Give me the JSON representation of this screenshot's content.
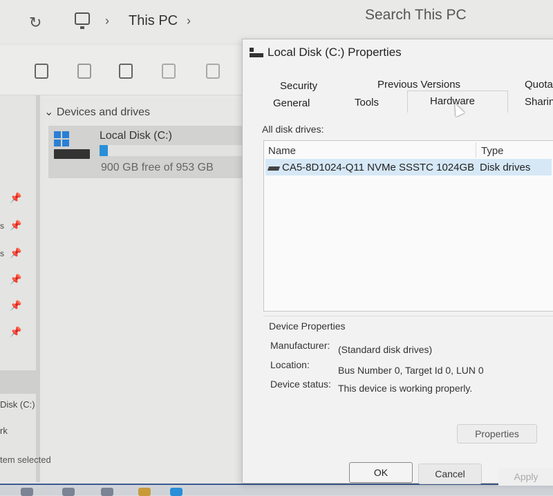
{
  "explorer": {
    "breadcrumb": "This PC",
    "search_placeholder": "Search This PC",
    "devices_header": "Devices and drives",
    "disk": {
      "name": "Local Disk (C:)",
      "free_text": "900 GB free of 953 GB",
      "usage_fraction": 0.056
    },
    "nav": {
      "frag1": "s",
      "frag2": "s",
      "disk_label": "Disk (C:)",
      "frag3": "rk"
    },
    "status_text": "tem selected"
  },
  "dialog": {
    "title": "Local Disk (C:) Properties",
    "tabs": {
      "security": "Security",
      "previous_versions": "Previous Versions",
      "quota": "Quota",
      "general": "General",
      "tools": "Tools",
      "hardware": "Hardware",
      "sharing": "Sharing"
    },
    "all_drives_label": "All disk drives:",
    "columns": {
      "name": "Name",
      "type": "Type"
    },
    "drives": [
      {
        "name": "CA5-8D1024-Q11 NVMe SSSTC 1024GB",
        "type": "Disk drives"
      }
    ],
    "device_properties": {
      "legend": "Device Properties",
      "manufacturer_label": "Manufacturer:",
      "manufacturer_value": "(Standard disk drives)",
      "location_label": "Location:",
      "location_value": "Bus Number 0, Target Id 0, LUN 0",
      "status_label": "Device status:",
      "status_value": "This device is working properly.",
      "properties_button": "Properties"
    },
    "buttons": {
      "ok": "OK",
      "cancel": "Cancel",
      "apply": "Apply"
    }
  }
}
